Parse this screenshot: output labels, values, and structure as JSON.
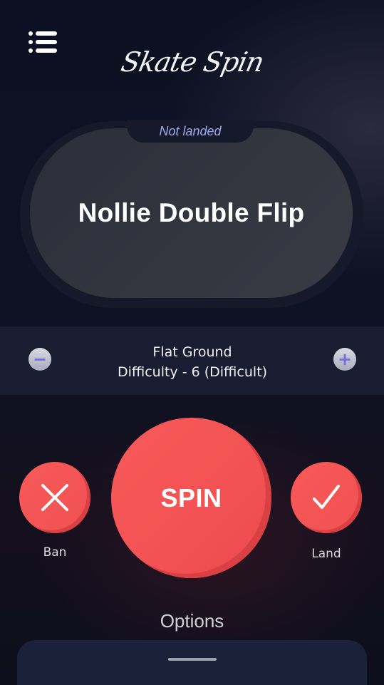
{
  "header": {
    "app_name": "Skate Spin",
    "menu_icon": "hamburger-menu-icon"
  },
  "trick": {
    "status": "Not landed",
    "name": "Nollie Double Flip"
  },
  "difficulty": {
    "terrain": "Flat Ground",
    "level_text": "Difficulty - 6 (Difficult)",
    "decrease_symbol": "−",
    "increase_symbol": "+"
  },
  "actions": {
    "spin_label": "SPIN",
    "ban_label": "Ban",
    "land_label": "Land"
  },
  "options": {
    "label": "Options"
  },
  "colors": {
    "accent_red": "#f25253",
    "status_blue": "#9ea8ef",
    "panel_navy": "#181d31"
  }
}
